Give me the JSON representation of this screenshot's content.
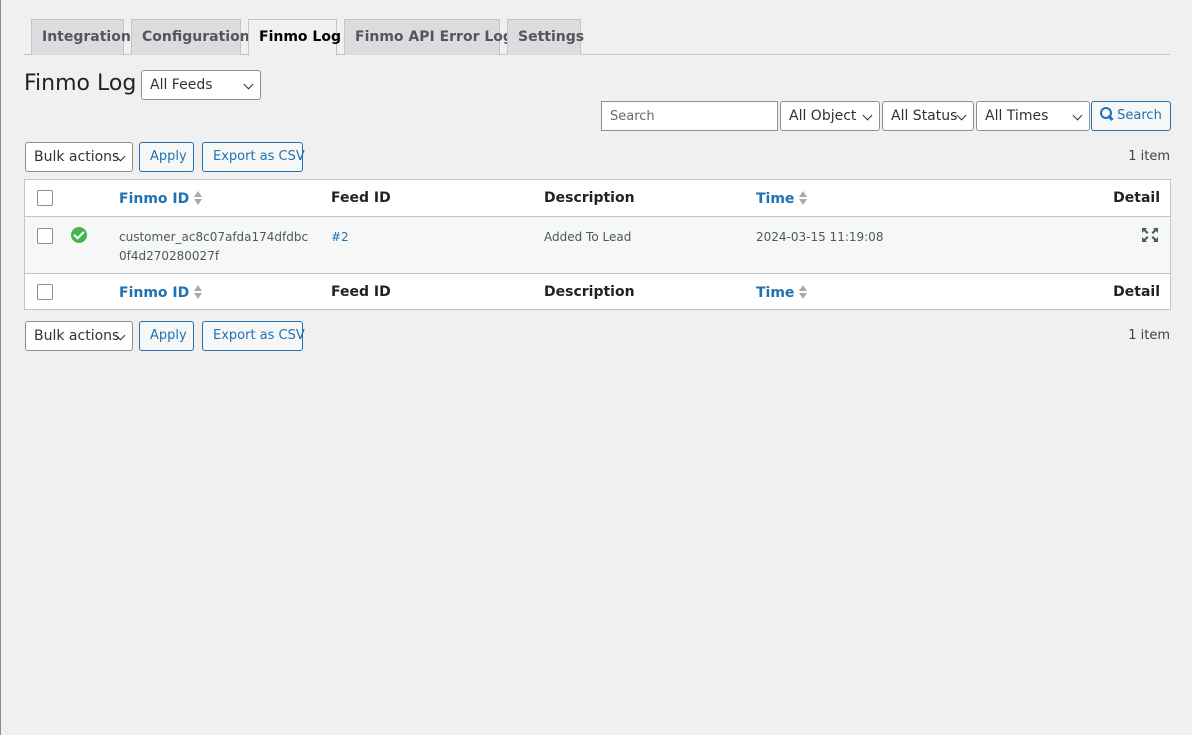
{
  "tabs": [
    {
      "label": "Integration",
      "active": false
    },
    {
      "label": "Configuration",
      "active": false
    },
    {
      "label": "Finmo Log",
      "active": true
    },
    {
      "label": "Finmo API Error Logs",
      "active": false
    },
    {
      "label": "Settings",
      "active": false
    }
  ],
  "page": {
    "title": "Finmo Log",
    "feed_filter": "All Feeds"
  },
  "filters": {
    "search_placeholder": "Search",
    "object": "All Object",
    "status": "All Status",
    "times": "All Times",
    "search_button": "Search"
  },
  "bulk": {
    "label": "Bulk actions",
    "apply": "Apply",
    "export": "Export as CSV"
  },
  "item_count": "1 item",
  "columns": {
    "finmo_id": "Finmo ID",
    "feed_id": "Feed ID",
    "description": "Description",
    "time": "Time",
    "detail": "Detail"
  },
  "rows": [
    {
      "status": "success",
      "finmo_id": "customer_ac8c07afda174dfdbc0f4d270280027f",
      "feed_id": "#2",
      "description": "Added To Lead",
      "time": "2024-03-15 11:19:08"
    }
  ],
  "colors": {
    "accent": "#2271b1",
    "success": "#46b450"
  }
}
